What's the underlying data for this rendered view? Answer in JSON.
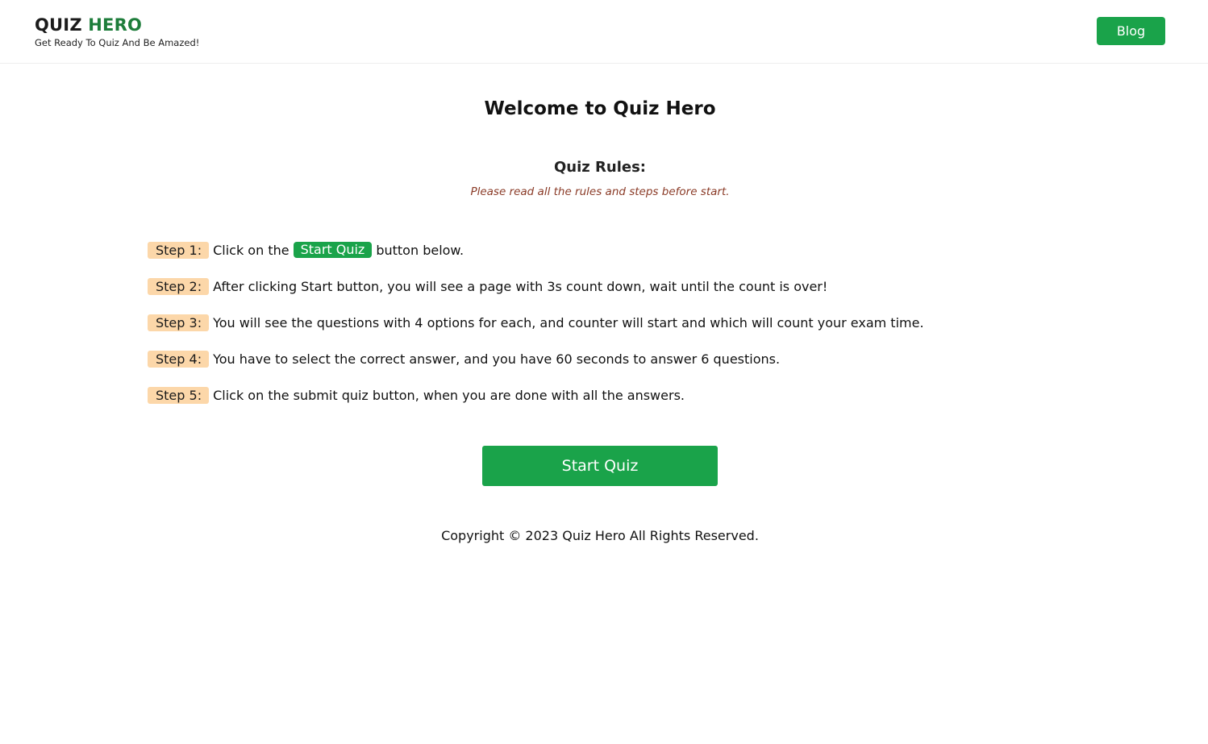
{
  "header": {
    "brand_part1": "QUIZ",
    "brand_part2": "HERO",
    "tagline": "Get Ready To Quiz And Be Amazed!",
    "blog_label": "Blog"
  },
  "main": {
    "welcome": "Welcome to Quiz Hero",
    "rules_title": "Quiz Rules:",
    "rules_note": "Please read all the rules and steps before start.",
    "steps": [
      {
        "label": "Step 1:",
        "text_before": "Click on the",
        "pill": "Start Quiz",
        "text_after": "button below."
      },
      {
        "label": "Step 2:",
        "text": "After clicking Start button, you will see a page with 3s count down, wait until the count is over!"
      },
      {
        "label": "Step 3:",
        "text": "You will see the questions with 4 options for each, and counter will start and which will count your exam time."
      },
      {
        "label": "Step 4:",
        "text": "You have to select the correct answer, and you have 60 seconds to answer 6 questions."
      },
      {
        "label": "Step 5:",
        "text": "Click on the submit quiz button, when you are done with all the answers."
      }
    ],
    "start_button": "Start Quiz"
  },
  "footer": {
    "copyright": "Copyright © 2023 Quiz Hero All Rights Reserved."
  },
  "colors": {
    "accent_green": "#1aa34a",
    "brand_green": "#1e7d3b",
    "step_badge_bg": "#fcd7a9",
    "note_color": "#8a3a26"
  }
}
